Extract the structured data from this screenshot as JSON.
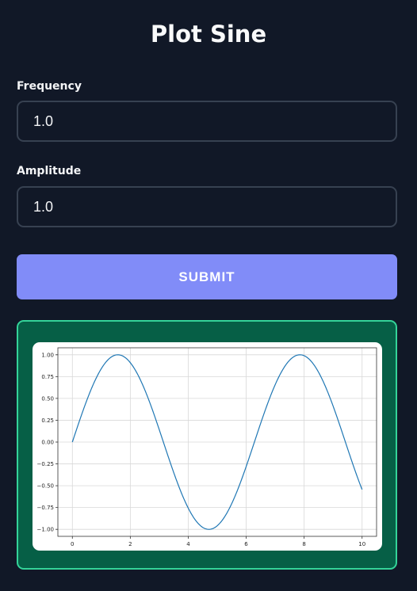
{
  "page": {
    "title": "Plot Sine"
  },
  "form": {
    "frequency": {
      "label": "Frequency",
      "value": "1.0"
    },
    "amplitude": {
      "label": "Amplitude",
      "value": "1.0"
    },
    "submit_label": "SUBMIT"
  },
  "colors": {
    "background": "#111827",
    "accent_button": "#818cf8",
    "panel_fill": "#065f46",
    "panel_border": "#34d399",
    "line": "#1f77b4"
  },
  "chart_data": {
    "type": "line",
    "function": "sin",
    "frequency": 1.0,
    "amplitude": 1.0,
    "xlim": [
      -0.5,
      10.5
    ],
    "ylim": [
      -1.08,
      1.08
    ],
    "x_range": [
      0,
      10
    ],
    "xticks": [
      0,
      2,
      4,
      6,
      8,
      10
    ],
    "yticks": [
      1.0,
      0.75,
      0.5,
      0.25,
      0.0,
      -0.25,
      -0.5,
      -0.75,
      -1.0
    ],
    "xtick_labels": [
      "0",
      "2",
      "4",
      "6",
      "8",
      "10"
    ],
    "ytick_labels": [
      "1.00",
      "0.75",
      "0.50",
      "0.25",
      "0.00",
      "−0.25",
      "−0.50",
      "−0.75",
      "−1.00"
    ],
    "grid": true,
    "title": "",
    "xlabel": "",
    "ylabel": ""
  }
}
